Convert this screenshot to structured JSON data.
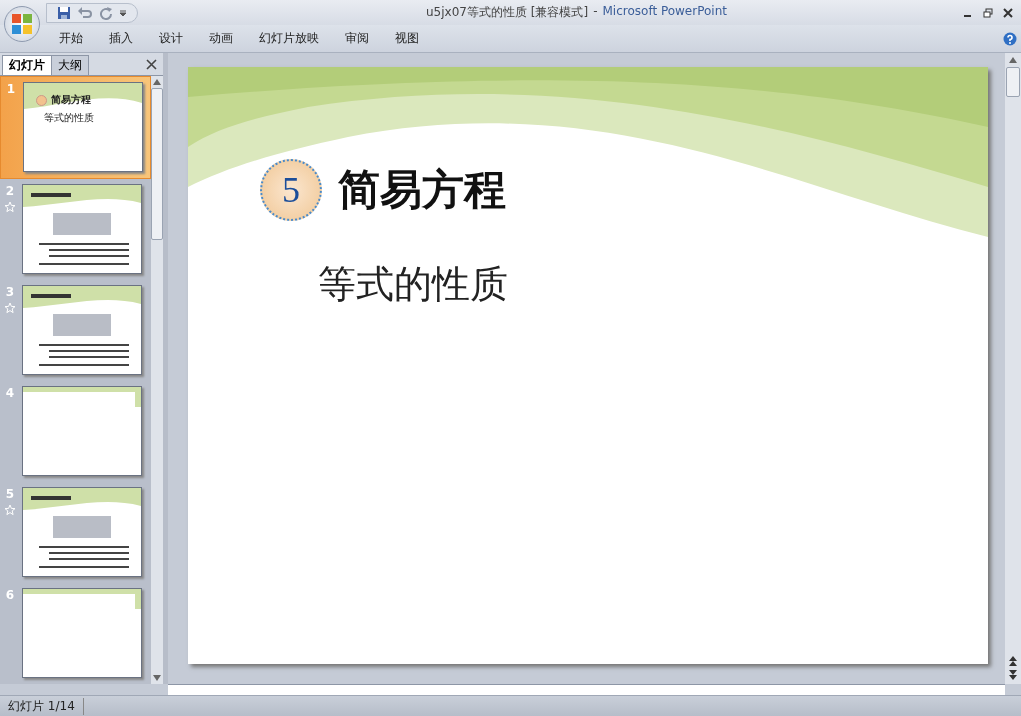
{
  "window": {
    "document_title": "u5jx07等式的性质 [兼容模式]",
    "separator": "-",
    "app_name": "Microsoft PowerPoint"
  },
  "ribbon_tabs": [
    {
      "label": "开始",
      "selected": false
    },
    {
      "label": "插入",
      "selected": false
    },
    {
      "label": "设计",
      "selected": false
    },
    {
      "label": "动画",
      "selected": false
    },
    {
      "label": "幻灯片放映",
      "selected": false
    },
    {
      "label": "审阅",
      "selected": false
    },
    {
      "label": "视图",
      "selected": false
    }
  ],
  "panel_tabs": [
    {
      "label": "幻灯片",
      "selected": true
    },
    {
      "label": "大纲",
      "selected": false
    }
  ],
  "slides": [
    {
      "number": "1",
      "kind": "title",
      "selected": true,
      "animated": false,
      "title": "简易方程",
      "subtitle": "等式的性质"
    },
    {
      "number": "2",
      "kind": "content",
      "selected": false,
      "animated": true
    },
    {
      "number": "3",
      "kind": "content",
      "selected": false,
      "animated": true
    },
    {
      "number": "4",
      "kind": "blank",
      "selected": false,
      "animated": false
    },
    {
      "number": "5",
      "kind": "content",
      "selected": false,
      "animated": true
    },
    {
      "number": "6",
      "kind": "blank",
      "selected": false,
      "animated": false
    }
  ],
  "slide": {
    "badge": "5",
    "title": "简易方程",
    "subtitle": "等式的性质"
  },
  "status_bar": {
    "slide_count": "幻灯片 1/14"
  }
}
